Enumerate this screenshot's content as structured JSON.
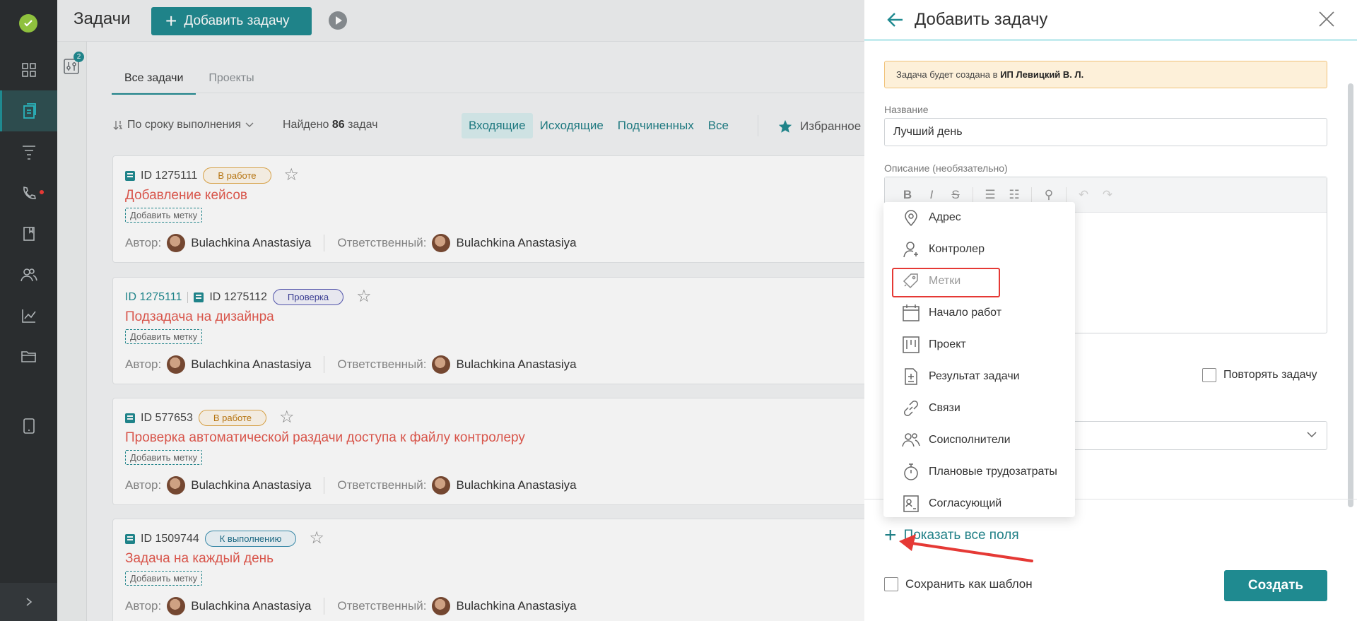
{
  "app": {
    "page_title": "Задачи",
    "add_task_label": "Добавить задачу",
    "filter_badge": "2"
  },
  "tabs": [
    {
      "label": "Все задачи",
      "active": true
    },
    {
      "label": "Проекты",
      "active": false
    }
  ],
  "toolbar": {
    "sort_label": "По сроку выполнения",
    "found_prefix": "Найдено",
    "found_count": "86",
    "found_suffix": "задач",
    "filters": [
      "Входящие",
      "Исходящие",
      "Подчиненных",
      "Все"
    ],
    "favorites": "Избранное"
  },
  "tasks": [
    {
      "parent_id": "",
      "id": "ID 1275111",
      "status": "В работе",
      "title": "Добавление кейсов",
      "tag": "Добавить метку",
      "author_label": "Автор:",
      "author": "Bulachkina Anastasiya",
      "resp_label": "Ответственный:",
      "responsible": "Bulachkina Anastasiya"
    },
    {
      "parent_id": "ID 1275111",
      "id": "ID 1275112",
      "status": "Проверка",
      "title": "Подзадача на дизайнра",
      "tag": "Добавить метку",
      "author_label": "Автор:",
      "author": "Bulachkina Anastasiya",
      "resp_label": "Ответственный:",
      "responsible": "Bulachkina Anastasiya"
    },
    {
      "parent_id": "",
      "id": "ID 577653",
      "status": "В работе",
      "title": "Проверка автоматической раздачи доступа к файлу контролеру",
      "tag": "Добавить метку",
      "author_label": "Автор:",
      "author": "Bulachkina Anastasiya",
      "resp_label": "Ответственный:",
      "responsible": "Bulachkina Anastasiya"
    },
    {
      "parent_id": "",
      "id": "ID 1509744",
      "status": "К выполнению",
      "title": "Задача на каждый день",
      "tag": "Добавить метку",
      "author_label": "Автор:",
      "author": "Bulachkina Anastasiya",
      "resp_label": "Ответственный:",
      "responsible": "Bulachkina Anastasiya"
    }
  ],
  "panel": {
    "title": "Добавить задачу",
    "notice_prefix": "Задача будет создана в",
    "notice_org": "ИП Левицкий В. Л.",
    "name_label": "Название",
    "name_value": "Лучший день",
    "desc_label": "Описание (необязательно)",
    "repeat_label": "Повторять задачу",
    "show_all_label": "Показать все поля",
    "save_template_label": "Сохранить как шаблон",
    "create_label": "Создать"
  },
  "menu": [
    {
      "label": "Адрес",
      "icon": "location-pin-icon"
    },
    {
      "label": "Контролер",
      "icon": "user-plus-icon"
    },
    {
      "label": "Метки",
      "icon": "tag-icon"
    },
    {
      "label": "Начало работ",
      "icon": "calendar-icon"
    },
    {
      "label": "Проект",
      "icon": "kanban-icon"
    },
    {
      "label": "Результат задачи",
      "icon": "document-icon"
    },
    {
      "label": "Связи",
      "icon": "link-icon"
    },
    {
      "label": "Соисполнители",
      "icon": "users-icon"
    },
    {
      "label": "Плановые трудозатраты",
      "icon": "stopwatch-icon"
    },
    {
      "label": "Согласующий",
      "icon": "approver-icon"
    }
  ],
  "colors": {
    "accent": "#1f8a90",
    "task_title": "#e4594e",
    "annotation": "#e53935"
  }
}
